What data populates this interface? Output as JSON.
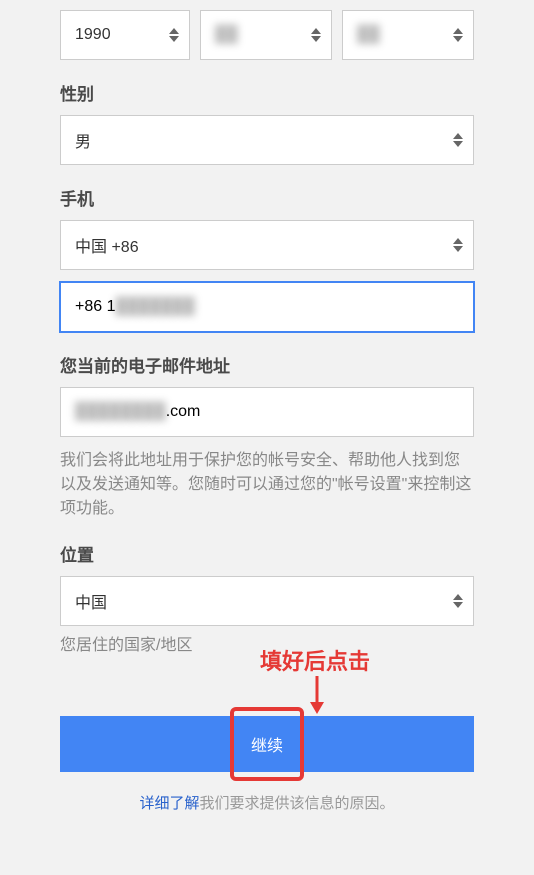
{
  "birthday": {
    "year": "1990",
    "month_blurred": "██",
    "day_blurred": "██"
  },
  "gender": {
    "label": "性别",
    "value": "男"
  },
  "phone": {
    "label": "手机",
    "country": "中国 +86",
    "value_prefix": "+86 1",
    "value_blurred": "███████"
  },
  "email": {
    "label": "您当前的电子邮件地址",
    "value_blurred": "████████",
    "value_suffix": ".com",
    "helper": "我们会将此地址用于保护您的帐号安全、帮助他人找到您以及发送通知等。您随时可以通过您的\"帐号设置\"来控制这项功能。"
  },
  "location": {
    "label": "位置",
    "value": "中国",
    "helper": "您居住的国家/地区"
  },
  "annotation": {
    "text": "填好后点击"
  },
  "button": {
    "label": "继续"
  },
  "footer": {
    "link": "详细了解",
    "text": "我们要求提供该信息的原因。"
  }
}
